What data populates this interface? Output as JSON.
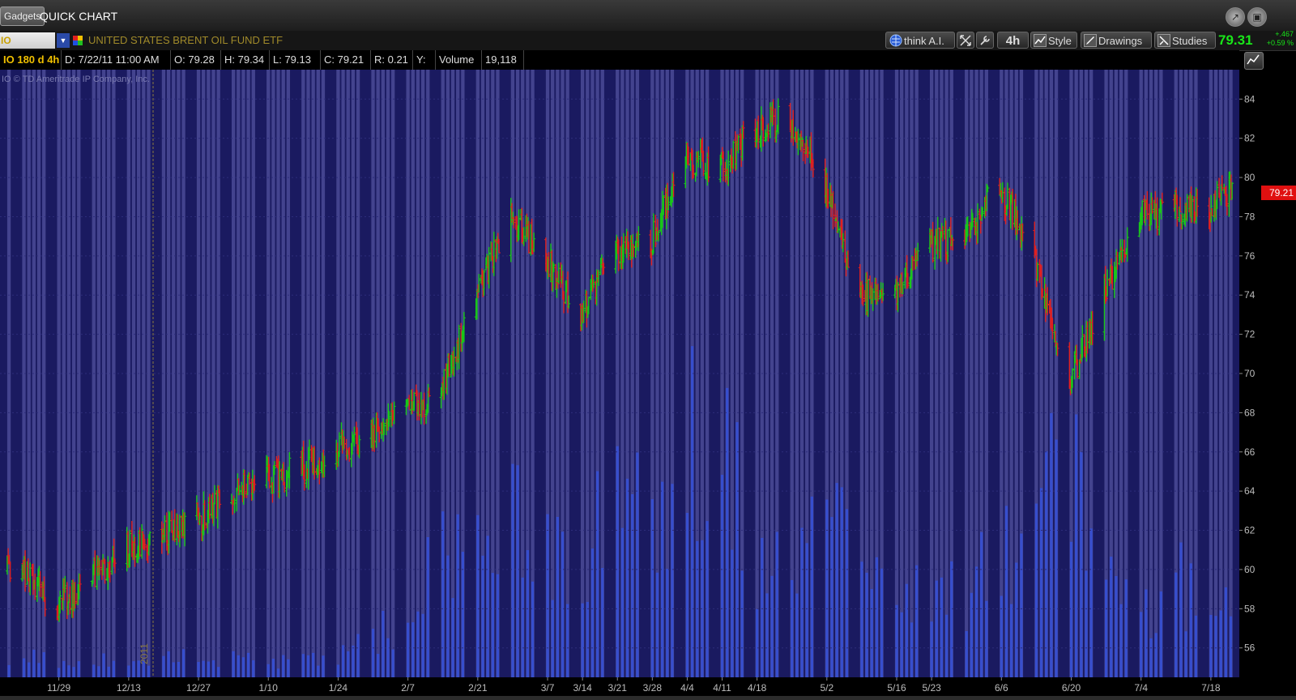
{
  "window": {
    "gadgets_tab": "Gadgets",
    "title": "QUICK CHART"
  },
  "toolbar": {
    "symbol": "IO",
    "description": "UNITED STATES BRENT OIL FUND ETF",
    "think_ai": "think A.I.",
    "aggregation": "4h",
    "style": "Style",
    "drawings": "Drawings",
    "studies": "Studies",
    "last_price": "79.31",
    "net_change": "+.467",
    "pct_change": "+0.59 %"
  },
  "info_bar": {
    "period": "IO 180 d 4h",
    "date": "D: 7/22/11 11:00 AM",
    "open": "O: 79.28",
    "high": "H: 79.34",
    "low": "L: 79.13",
    "close": "C: 79.21",
    "range": "R: 0.21",
    "y": "Y:",
    "volume_label": "Volume",
    "volume_value": "19,118"
  },
  "copyright": "IO © TD Ameritrade IP Company, Inc.",
  "price_badge": "79.21",
  "colors": {
    "background": "#1a1a60",
    "up_bar": "#18c818",
    "down_bar": "#e02020",
    "volume": "#3550d8",
    "bar_stripe": "#52529e"
  },
  "chart_data": {
    "type": "line",
    "subtype": "ohlc_bars_with_volume",
    "aggregation": "4h",
    "period": "180 d",
    "ylim": [
      54.5,
      85.5
    ],
    "y_ticks": [
      56,
      58,
      60,
      62,
      64,
      66,
      68,
      70,
      72,
      74,
      76,
      78,
      80,
      82,
      84
    ],
    "x_tick_labels": [
      "11/29",
      "12/13",
      "12/27",
      "1/10",
      "1/24",
      "2/7",
      "2/21",
      "3/7",
      "3/14",
      "3/21",
      "3/28",
      "4/4",
      "4/11",
      "4/18",
      "5/2",
      "5/16",
      "5/23",
      "6/6",
      "6/20",
      "7/4",
      "7/18"
    ],
    "year_marker": "2011",
    "series": [
      {
        "name": "",
        "x": [
          "11/22",
          "11/29",
          "12/13",
          "12/27",
          "1/3",
          "1/10",
          "1/24",
          "2/7",
          "2/14",
          "2/21",
          "2/28",
          "3/7",
          "3/14",
          "3/21",
          "3/28",
          "4/4",
          "4/11",
          "4/18",
          "4/25",
          "5/2",
          "5/9",
          "5/16",
          "5/23",
          "5/30",
          "6/6",
          "6/13",
          "6/20",
          "6/27",
          "7/4",
          "7/11",
          "7/18",
          "7/22"
        ],
        "values": [
          60,
          58,
          61,
          62.5,
          64,
          64.5,
          66,
          68,
          69,
          74,
          78,
          76,
          73,
          76,
          76.5,
          81,
          80.5,
          82.5,
          83,
          80,
          74,
          74,
          76.5,
          77,
          79.5,
          76,
          69.5,
          74,
          78,
          78.5,
          78.5,
          79.21
        ]
      }
    ],
    "volume": {
      "ylim": [
        0,
        200000
      ],
      "x": [
        "11/22",
        "11/29",
        "12/13",
        "12/27",
        "1/10",
        "1/24",
        "2/7",
        "2/21",
        "2/28",
        "3/7",
        "3/14",
        "3/21",
        "3/28",
        "4/4",
        "4/11",
        "4/18",
        "5/2",
        "5/9",
        "5/16",
        "5/23",
        "6/6",
        "6/13",
        "6/20",
        "6/27",
        "7/4",
        "7/11",
        "7/18"
      ],
      "values": [
        18000,
        14000,
        12000,
        15000,
        12000,
        14000,
        45000,
        150000,
        120000,
        100000,
        90000,
        130000,
        110000,
        170000,
        160000,
        90000,
        120000,
        70000,
        60000,
        55000,
        80000,
        120000,
        160000,
        75000,
        50000,
        70000,
        60000
      ]
    }
  }
}
